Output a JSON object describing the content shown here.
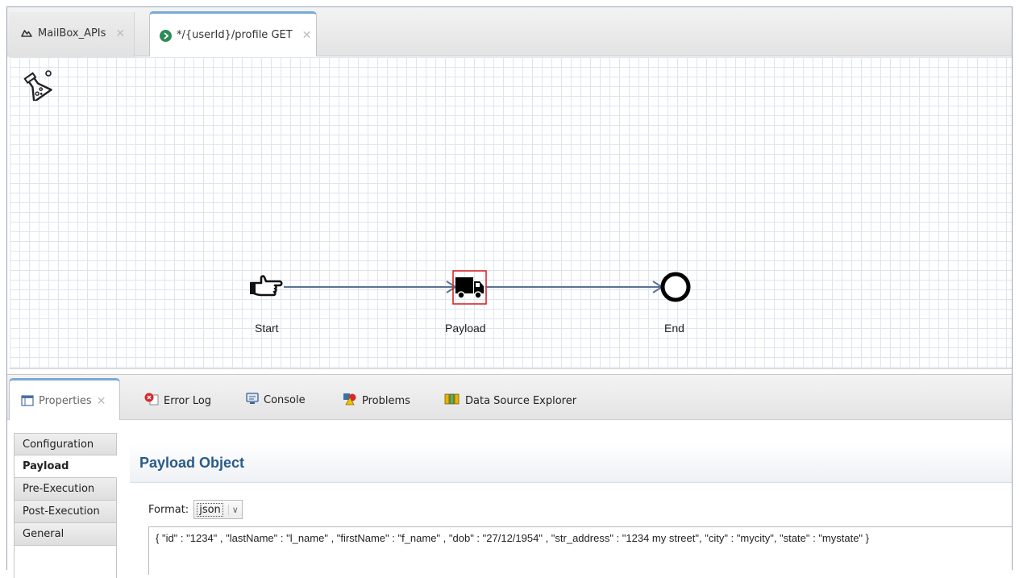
{
  "editor_tabs": [
    {
      "label": "MailBox_APIs",
      "icon": "cloud-icon",
      "active": false
    },
    {
      "label": "*/{userId}/profile GET",
      "icon": "run-icon",
      "active": true
    }
  ],
  "flow": {
    "nodes": [
      {
        "label": "Start",
        "icon": "pointing-hand-icon"
      },
      {
        "label": "Payload",
        "icon": "truck-icon",
        "selected": true
      },
      {
        "label": "End",
        "icon": "end-circle-icon"
      }
    ],
    "connector_color": "#5a7391",
    "selection_color": "#d9262b"
  },
  "panel_tabs": [
    {
      "label": "Properties",
      "icon": "properties-icon",
      "active": true
    },
    {
      "label": "Error Log",
      "icon": "error-log-icon"
    },
    {
      "label": "Console",
      "icon": "console-icon"
    },
    {
      "label": "Problems",
      "icon": "problems-icon"
    },
    {
      "label": "Data Source Explorer",
      "icon": "data-source-icon"
    }
  ],
  "properties": {
    "sections": [
      "Configuration",
      "Payload",
      "Pre-Execution",
      "Post-Execution",
      "General"
    ],
    "selected_section": "Payload",
    "title": "Payload Object",
    "format_label": "Format:",
    "format_value": "json",
    "payload": "{ \"id\" : \"1234\" , \"lastName\" : \"l_name\" , \"firstName\" : \"f_name\" , \"dob\" : \"27/12/1954\" , \"str_address\" : \"1234 my street\", \"city\" : \"mycity\", \"state\" : \"mystate\" }"
  },
  "colors": {
    "accent_tab": "#78a9d8",
    "section_title": "#2a5b86",
    "grid": "#dde6ef"
  }
}
